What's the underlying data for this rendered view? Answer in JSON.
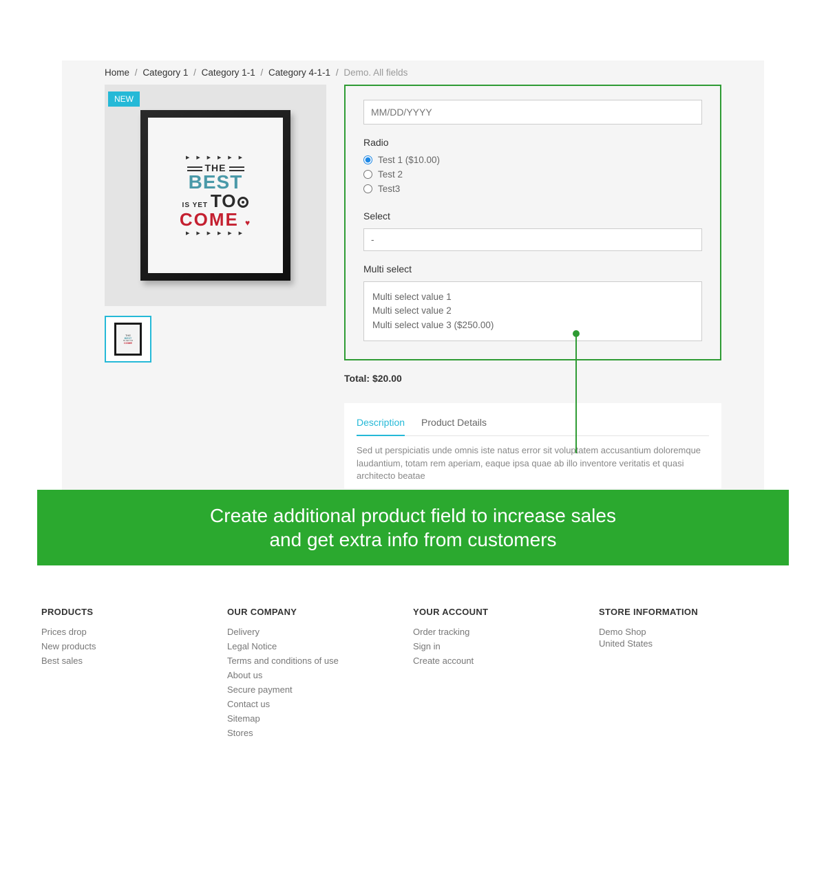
{
  "breadcrumbs": {
    "home": "Home",
    "cat1": "Category 1",
    "cat11": "Category 1-1",
    "cat411": "Category 4-1-1",
    "current": "Demo. All fields"
  },
  "badge_new": "NEW",
  "poster": {
    "line1": "THE",
    "line2": "BEST",
    "line3a": "IS YET",
    "line3b": "TO",
    "line4": "COME"
  },
  "fields": {
    "date_placeholder": "MM/DD/YYYY",
    "radio_label": "Radio",
    "radio_options": {
      "o1": "Test 1 ($10.00)",
      "o2": "Test 2",
      "o3": "Test3"
    },
    "select_label": "Select",
    "select_value": "-",
    "multi_label": "Multi select",
    "multi_options": {
      "m1": "Multi select value 1",
      "m2": "Multi select value 2",
      "m3": "Multi select value 3 ($250.00)"
    }
  },
  "total": "Total: $20.00",
  "tabs": {
    "t1": "Description",
    "t2": "Product Details"
  },
  "description_text": "Sed ut perspiciatis unde omnis iste natus error sit voluptatem accusantium doloremque laudantium, totam rem aperiam, eaque ipsa quae ab illo inventore veritatis et quasi architecto beatae",
  "callout_line1": "Create additional product field to increase sales",
  "callout_line2": "and get extra info from customers",
  "footer": {
    "col1": {
      "title": "PRODUCTS",
      "l1": "Prices drop",
      "l2": "New products",
      "l3": "Best sales"
    },
    "col2": {
      "title": "OUR COMPANY",
      "l1": "Delivery",
      "l2": "Legal Notice",
      "l3": "Terms and conditions of use",
      "l4": "About us",
      "l5": "Secure payment",
      "l6": "Contact us",
      "l7": "Sitemap",
      "l8": "Stores"
    },
    "col3": {
      "title": "YOUR ACCOUNT",
      "l1": "Order tracking",
      "l2": "Sign in",
      "l3": "Create account"
    },
    "col4": {
      "title": "STORE INFORMATION",
      "l1": "Demo Shop",
      "l2": "United States"
    }
  }
}
